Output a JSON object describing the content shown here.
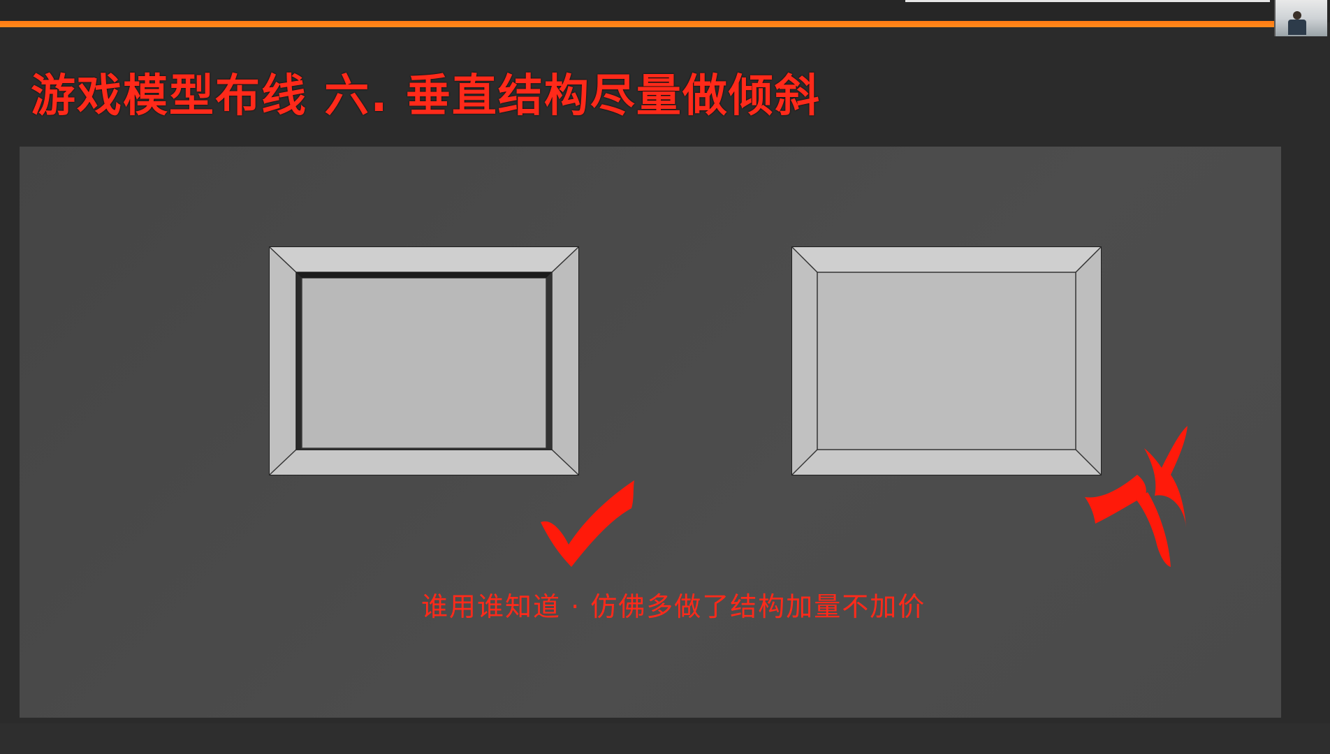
{
  "slide": {
    "title": "游戏模型布线  六. 垂直结构尽量做倾斜",
    "caption": "谁用谁知道 · 仿佛多做了结构加量不加价"
  },
  "examples": [
    {
      "name": "beveled-frame",
      "verdict": "correct",
      "icon": "check-mark-icon"
    },
    {
      "name": "flat-frame",
      "verdict": "wrong",
      "icon": "cross-mark-icon"
    }
  ],
  "colors": {
    "accent": "#ff7a12",
    "title_red": "#ff2a1a",
    "panel_bg": "#4a4a4a",
    "frame_face": "#c4c4c4"
  }
}
